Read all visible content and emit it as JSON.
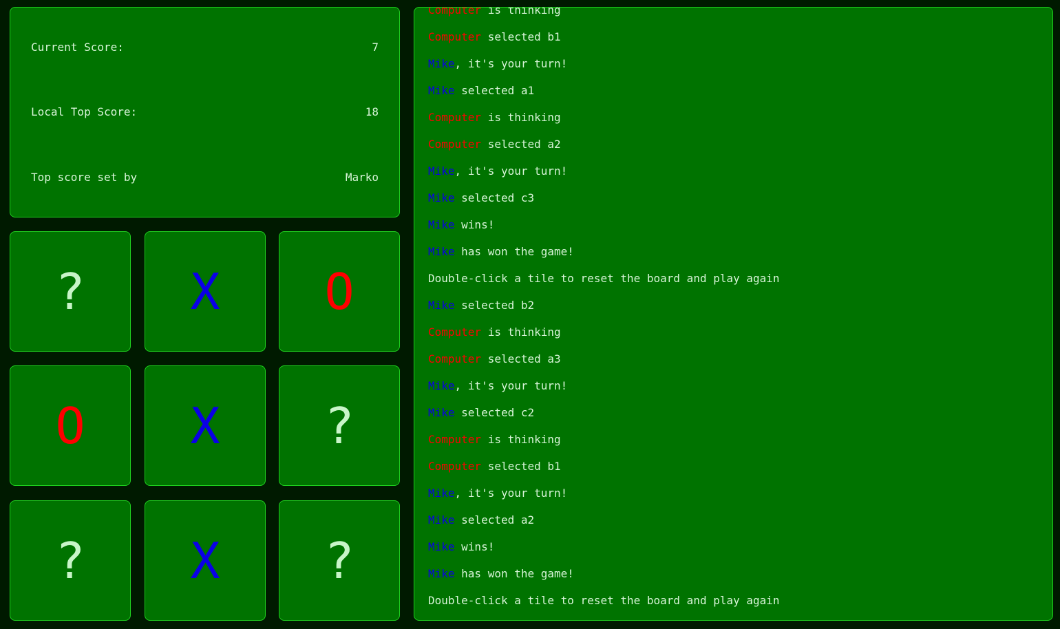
{
  "scores": {
    "current_label": "Current Score:",
    "current_value": "7",
    "top_label": "Local Top Score:",
    "top_value": "18",
    "setby_label": "Top score set by",
    "setby_value": "Marko"
  },
  "board": {
    "tiles": [
      {
        "id": "a1",
        "mark": "?"
      },
      {
        "id": "a2",
        "mark": "X"
      },
      {
        "id": "a3",
        "mark": "O"
      },
      {
        "id": "b1",
        "mark": "O"
      },
      {
        "id": "b2",
        "mark": "X"
      },
      {
        "id": "b3",
        "mark": "?"
      },
      {
        "id": "c1",
        "mark": "?"
      },
      {
        "id": "c2",
        "mark": "X"
      },
      {
        "id": "c3",
        "mark": "?"
      }
    ]
  },
  "colors": {
    "background": "#001a00",
    "panel": "#007300",
    "border": "#1fcf1f",
    "player": "#0a00e6",
    "computer": "#ff0000",
    "text": "#d8f5d8"
  },
  "log": [
    {
      "who": "Computer",
      "role": "computer",
      "text": " is thinking"
    },
    {
      "who": "Computer",
      "role": "computer",
      "text": " selected b1"
    },
    {
      "who": "Mike",
      "role": "player",
      "text": ", it's your turn!"
    },
    {
      "who": "Mike",
      "role": "player",
      "text": " selected a1"
    },
    {
      "who": "Computer",
      "role": "computer",
      "text": " is thinking"
    },
    {
      "who": "Computer",
      "role": "computer",
      "text": " selected a2"
    },
    {
      "who": "Mike",
      "role": "player",
      "text": ", it's your turn!"
    },
    {
      "who": "Mike",
      "role": "player",
      "text": " selected c3"
    },
    {
      "who": "Mike",
      "role": "player",
      "text": " wins!"
    },
    {
      "who": "Mike",
      "role": "player",
      "text": " has won the game!"
    },
    {
      "who": "",
      "role": "",
      "text": "Double-click a tile to reset the board and play again"
    },
    {
      "who": "Mike",
      "role": "player",
      "text": " selected b2"
    },
    {
      "who": "Computer",
      "role": "computer",
      "text": " is thinking"
    },
    {
      "who": "Computer",
      "role": "computer",
      "text": " selected a3"
    },
    {
      "who": "Mike",
      "role": "player",
      "text": ", it's your turn!"
    },
    {
      "who": "Mike",
      "role": "player",
      "text": " selected c2"
    },
    {
      "who": "Computer",
      "role": "computer",
      "text": " is thinking"
    },
    {
      "who": "Computer",
      "role": "computer",
      "text": " selected b1"
    },
    {
      "who": "Mike",
      "role": "player",
      "text": ", it's your turn!"
    },
    {
      "who": "Mike",
      "role": "player",
      "text": " selected a2"
    },
    {
      "who": "Mike",
      "role": "player",
      "text": " wins!"
    },
    {
      "who": "Mike",
      "role": "player",
      "text": " has won the game!"
    },
    {
      "who": "",
      "role": "",
      "text": "Double-click a tile to reset the board and play again"
    }
  ]
}
